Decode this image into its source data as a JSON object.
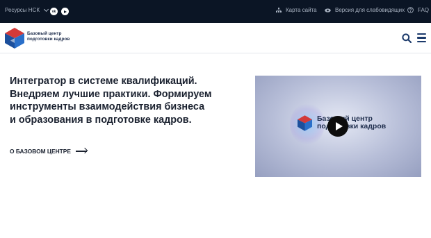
{
  "topbar": {
    "resources_label": "Ресурсы НСК",
    "social": [
      {
        "name": "vk-icon",
        "glyph": "vk"
      },
      {
        "name": "youtube-icon",
        "glyph": ""
      }
    ],
    "links": {
      "sitemap": "Карта сайта",
      "vision": "Версия для слабовидящих",
      "faq": "FAQ"
    }
  },
  "header": {
    "logo_line1": "Базовый центр",
    "logo_line2": "подготовки кадров"
  },
  "hero": {
    "line1": "Интегратор в системе квалификаций.",
    "line2": "Внедряем лучшие практики. Формируем",
    "line3": "инструменты взаимодействия бизнеса",
    "line4": "и образования в подготовке кадров.",
    "about_link": "О БАЗОВОМ ЦЕНТРЕ"
  },
  "video": {
    "title_line1": "Базовый центр",
    "title_line2": "подготовки кадров"
  },
  "colors": {
    "topbar_bg": "#0b1525",
    "brand_red": "#d23a3a",
    "brand_blue": "#1c4f9c",
    "brand_dark": "#1b2230"
  }
}
